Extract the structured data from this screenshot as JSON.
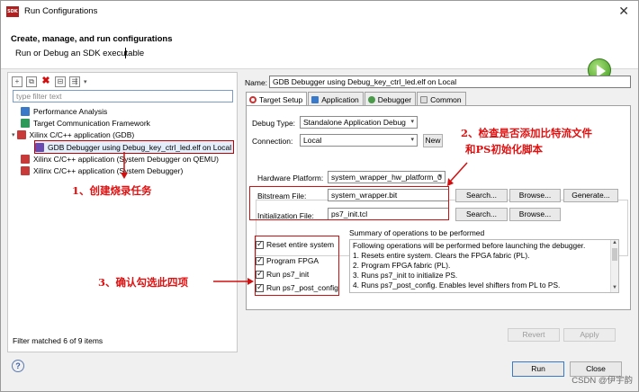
{
  "window": {
    "title": "Run Configurations",
    "icon_text": "SDK"
  },
  "header": {
    "title": "Create, manage, and run configurations",
    "subtitle": "Run or Debug an SDK executable"
  },
  "left": {
    "filter_placeholder": "type filter text",
    "tree": [
      {
        "label": "Performance Analysis",
        "icon": "performance-icon"
      },
      {
        "label": "Target Communication Framework",
        "icon": "tcf-icon"
      },
      {
        "label": "Xilinx C/C++ application (GDB)",
        "icon": "xilinx-gdb-icon"
      },
      {
        "label": "GDB Debugger using Debug_key_ctrl_led.elf on Local",
        "icon": "config-icon"
      },
      {
        "label": "Xilinx C/C++ application (System Debugger on QEMU)",
        "icon": "xilinx-qemu-icon"
      },
      {
        "label": "Xilinx C/C++ application (System Debugger)",
        "icon": "xilinx-sysdbg-icon"
      }
    ],
    "status": "Filter matched 6 of 9 items"
  },
  "right": {
    "name_label": "Name:",
    "name_value": "GDB Debugger using Debug_key_ctrl_led.elf on Local",
    "tabs": [
      "Target Setup",
      "Application",
      "Debugger",
      "Common"
    ],
    "debug_type_label": "Debug Type:",
    "debug_type_value": "Standalone Application Debug",
    "connection_label": "Connection:",
    "connection_value": "Local",
    "new_button": "New",
    "hw_platform_label": "Hardware Platform:",
    "hw_platform_value": "system_wrapper_hw_platform_0",
    "bitstream_label": "Bitstream File:",
    "bitstream_value": "system_wrapper.bit",
    "init_label": "Initialization File:",
    "init_value": "ps7_init.tcl",
    "search_button": "Search...",
    "browse_button": "Browse...",
    "generate_button": "Generate...",
    "checkboxes": [
      "Reset entire system",
      "Program FPGA",
      "Run ps7_init",
      "Run ps7_post_config"
    ],
    "summary_label": "Summary of operations to be performed",
    "summary_lines": [
      "Following operations will be performed before launching the debugger.",
      "1. Resets entire system. Clears the FPGA fabric (PL).",
      "2. Program FPGA fabric (PL).",
      "3. Runs ps7_init to initialize PS.",
      "4. Runs ps7_post_config. Enables level shifters from PL to PS."
    ],
    "revert_button": "Revert",
    "apply_button": "Apply"
  },
  "footer": {
    "run_button": "Run",
    "close_button": "Close",
    "watermark": "CSDN @伊宇韵"
  },
  "annotations": {
    "a1": "1、创建烧录任务",
    "a2_line1": "2、检查是否添加比特流文件",
    "a2_line2": "和PS初始化脚本",
    "a3": "3、确认勾选此四项"
  },
  "colors": {
    "annotation": "#e01010",
    "selection": "#e4eefb",
    "run_icon": "#3f9a1e"
  }
}
